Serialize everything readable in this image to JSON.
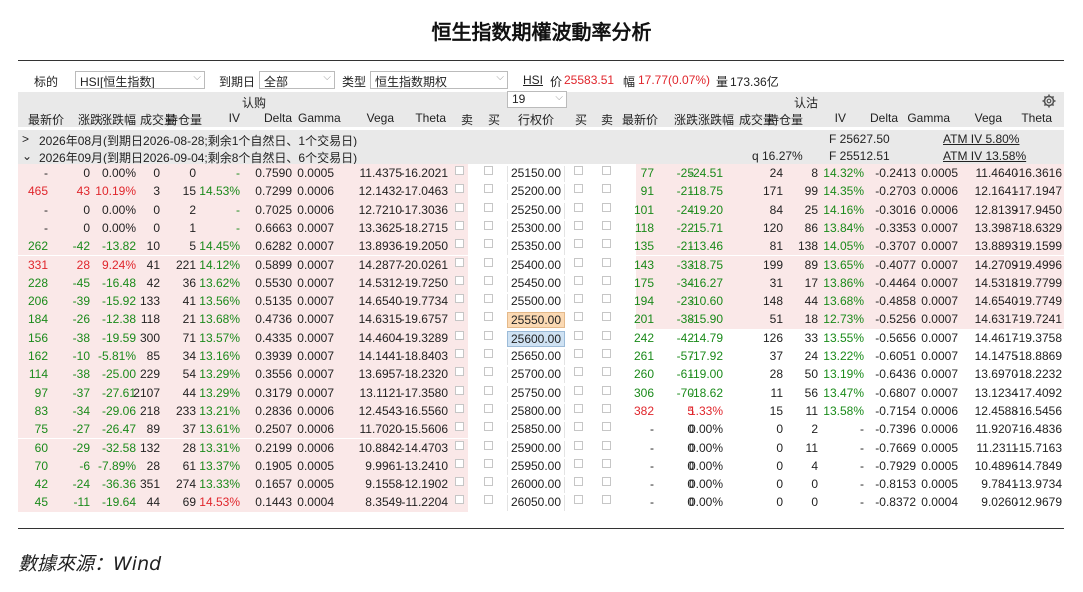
{
  "title": "恒生指数期權波動率分析",
  "source": "數據來源：Wind",
  "filter": {
    "underlying_label": "标的",
    "underlying_value": "HSI[恒生指数]",
    "expiry_label": "到期日",
    "expiry_value": "全部",
    "type_label": "类型",
    "type_value": "恒生指数期权",
    "hsi_link": "HSI",
    "price_label": "价",
    "price_value": "25583.51",
    "change_label": "幅",
    "change_value": "17.77(0.07%)",
    "volume_label": "量",
    "volume_value": "173.36亿"
  },
  "group_header": {
    "call_label": "认购",
    "strike_count": "19",
    "put_label": "认沽"
  },
  "columns": {
    "call": [
      "最新价",
      "涨跌",
      "涨跌幅",
      "成交量",
      "持仓量",
      "IV",
      "Delta",
      "Gamma",
      "Vega",
      "Theta",
      "卖",
      "买"
    ],
    "strike": "行权价",
    "put": [
      "买",
      "卖",
      "最新价",
      "涨跌",
      "涨跌幅",
      "成交量",
      "持仓量",
      "IV",
      "Delta",
      "Gamma",
      "Vega",
      "Theta"
    ]
  },
  "expiries": [
    {
      "label": "2026年08月(到期日2026-08-28;剩余1个自然日、1个交易日)",
      "q": "",
      "f": "F  25627.50",
      "atm": "ATM IV 5.80%"
    },
    {
      "label": "2026年09月(到期日2026-09-04;剩余8个自然日、6个交易日)",
      "q": "q  16.27%",
      "f": "F  25512.51",
      "atm": "ATM IV 13.58%"
    }
  ],
  "icons": {
    "settings": "gear-icon",
    "collapse": "chevron-icon",
    "dropdown": "chevron-down-icon",
    "checkbox": "checkbox-icon"
  },
  "colors": {
    "up": "#e0262c",
    "down": "#1a8a1a",
    "itm_background": "#fae8e8",
    "header_background": "#e9e9e9",
    "highlight_orange": "#fbd9b3",
    "highlight_blue": "#cfe2f3"
  },
  "rows": [
    {
      "c": [
        "-",
        "0",
        "0.00%",
        "0",
        "0",
        "-",
        "0.7590",
        "0.0005",
        "11.4375",
        "-16.2021"
      ],
      "k": "25150.00",
      "p": [
        "77",
        "-25",
        "-24.51",
        "24",
        "8",
        "14.32%",
        "-0.2413",
        "0.0005",
        "11.4640",
        "-16.3616"
      ]
    },
    {
      "c": [
        "465",
        "43",
        "10.19%",
        "3",
        "15",
        "14.53%",
        "0.7299",
        "0.0006",
        "12.1432",
        "-17.0463"
      ],
      "k": "25200.00",
      "p": [
        "91",
        "-21",
        "-18.75",
        "171",
        "99",
        "14.35%",
        "-0.2703",
        "0.0006",
        "12.1641",
        "-17.1947"
      ]
    },
    {
      "c": [
        "-",
        "0",
        "0.00%",
        "0",
        "2",
        "-",
        "0.7025",
        "0.0006",
        "12.7210",
        "-17.3036"
      ],
      "k": "25250.00",
      "p": [
        "101",
        "-24",
        "-19.20",
        "84",
        "25",
        "14.16%",
        "-0.3016",
        "0.0006",
        "12.8139",
        "-17.9450"
      ]
    },
    {
      "c": [
        "-",
        "0",
        "0.00%",
        "0",
        "1",
        "-",
        "0.6663",
        "0.0007",
        "13.3625",
        "-18.2715"
      ],
      "k": "25300.00",
      "p": [
        "118",
        "-22",
        "-15.71",
        "120",
        "86",
        "13.84%",
        "-0.3353",
        "0.0007",
        "13.3987",
        "-18.6329"
      ]
    },
    {
      "c": [
        "262",
        "-42",
        "-13.82",
        "10",
        "5",
        "14.45%",
        "0.6282",
        "0.0007",
        "13.8936",
        "-19.2050"
      ],
      "k": "25350.00",
      "p": [
        "135",
        "-21",
        "-13.46",
        "81",
        "138",
        "14.05%",
        "-0.3707",
        "0.0007",
        "13.8893",
        "-19.1599"
      ]
    },
    {
      "c": [
        "331",
        "28",
        "9.24%",
        "41",
        "221",
        "14.12%",
        "0.5899",
        "0.0007",
        "14.2877",
        "-20.0261"
      ],
      "k": "25400.00",
      "p": [
        "143",
        "-33",
        "-18.75",
        "199",
        "89",
        "13.65%",
        "-0.4077",
        "0.0007",
        "14.2709",
        "-19.4996"
      ]
    },
    {
      "c": [
        "228",
        "-45",
        "-16.48",
        "42",
        "36",
        "13.62%",
        "0.5530",
        "0.0007",
        "14.5312",
        "-19.7250"
      ],
      "k": "25450.00",
      "p": [
        "175",
        "-34",
        "-16.27",
        "31",
        "17",
        "13.86%",
        "-0.4464",
        "0.0007",
        "14.5318",
        "-19.7799"
      ]
    },
    {
      "c": [
        "206",
        "-39",
        "-15.92",
        "133",
        "41",
        "13.56%",
        "0.5135",
        "0.0007",
        "14.6540",
        "-19.7734"
      ],
      "k": "25500.00",
      "p": [
        "194",
        "-23",
        "-10.60",
        "148",
        "44",
        "13.68%",
        "-0.4858",
        "0.0007",
        "14.6540",
        "-19.7749"
      ]
    },
    {
      "c": [
        "184",
        "-26",
        "-12.38",
        "118",
        "21",
        "13.68%",
        "0.4736",
        "0.0007",
        "14.6315",
        "-19.6757"
      ],
      "k": "25550.00",
      "p": [
        "201",
        "-38",
        "-15.90",
        "51",
        "18",
        "12.73%",
        "-0.5256",
        "0.0007",
        "14.6317",
        "-19.7241"
      ]
    },
    {
      "c": [
        "156",
        "-38",
        "-19.59",
        "300",
        "71",
        "13.57%",
        "0.4335",
        "0.0007",
        "14.4604",
        "-19.3289"
      ],
      "k": "25600.00",
      "p": [
        "242",
        "-42",
        "-14.79",
        "126",
        "33",
        "13.55%",
        "-0.5656",
        "0.0007",
        "14.4617",
        "-19.3758"
      ]
    },
    {
      "c": [
        "162",
        "-10",
        "-5.81%",
        "85",
        "34",
        "13.16%",
        "0.3939",
        "0.0007",
        "14.1441",
        "-18.8403"
      ],
      "k": "25650.00",
      "p": [
        "261",
        "-57",
        "-17.92",
        "37",
        "24",
        "13.22%",
        "-0.6051",
        "0.0007",
        "14.1475",
        "-18.8869"
      ]
    },
    {
      "c": [
        "114",
        "-38",
        "-25.00",
        "229",
        "54",
        "13.29%",
        "0.3556",
        "0.0007",
        "13.6957",
        "-18.2320"
      ],
      "k": "25700.00",
      "p": [
        "260",
        "-61",
        "-19.00",
        "28",
        "50",
        "13.19%",
        "-0.6436",
        "0.0007",
        "13.6970",
        "-18.2232"
      ]
    },
    {
      "c": [
        "97",
        "-37",
        "-27.61",
        "2107",
        "44",
        "13.29%",
        "0.3179",
        "0.0007",
        "13.1121",
        "-17.3580"
      ],
      "k": "25750.00",
      "p": [
        "306",
        "-70",
        "-18.62",
        "11",
        "56",
        "13.47%",
        "-0.6807",
        "0.0007",
        "13.1234",
        "-17.4092"
      ]
    },
    {
      "c": [
        "83",
        "-34",
        "-29.06",
        "218",
        "233",
        "13.21%",
        "0.2836",
        "0.0006",
        "12.4543",
        "-16.5560"
      ],
      "k": "25800.00",
      "p": [
        "382",
        "5",
        "1.33%",
        "15",
        "11",
        "13.58%",
        "-0.7154",
        "0.0006",
        "12.4588",
        "-16.5456"
      ]
    },
    {
      "c": [
        "75",
        "-27",
        "-26.47",
        "89",
        "37",
        "13.61%",
        "0.2507",
        "0.0006",
        "11.7020",
        "-15.5606"
      ],
      "k": "25850.00",
      "p": [
        "-",
        "0",
        "0.00%",
        "0",
        "2",
        "-",
        "-0.7396",
        "0.0006",
        "11.9207",
        "-16.4836"
      ]
    },
    {
      "c": [
        "60",
        "-29",
        "-32.58",
        "132",
        "28",
        "13.31%",
        "0.2199",
        "0.0006",
        "10.8842",
        "-14.4703"
      ],
      "k": "25900.00",
      "p": [
        "-",
        "0",
        "0.00%",
        "0",
        "11",
        "-",
        "-0.7669",
        "0.0005",
        "11.2311",
        "-15.7163"
      ]
    },
    {
      "c": [
        "70",
        "-6",
        "-7.89%",
        "28",
        "61",
        "13.37%",
        "0.1905",
        "0.0005",
        "9.9961",
        "-13.2410"
      ],
      "k": "25950.00",
      "p": [
        "-",
        "0",
        "0.00%",
        "0",
        "4",
        "-",
        "-0.7929",
        "0.0005",
        "10.4896",
        "-14.7849"
      ]
    },
    {
      "c": [
        "42",
        "-24",
        "-36.36",
        "351",
        "274",
        "13.33%",
        "0.1657",
        "0.0005",
        "9.1558",
        "-12.1902"
      ],
      "k": "26000.00",
      "p": [
        "-",
        "0",
        "0.00%",
        "0",
        "0",
        "-",
        "-0.8153",
        "0.0005",
        "9.7841",
        "-13.9734"
      ]
    },
    {
      "c": [
        "45",
        "-11",
        "-19.64",
        "44",
        "69",
        "14.53%",
        "0.1443",
        "0.0004",
        "8.3549",
        "-11.2204"
      ],
      "k": "26050.00",
      "p": [
        "-",
        "0",
        "0.00%",
        "0",
        "0",
        "-",
        "-0.8372",
        "0.0004",
        "9.0260",
        "-12.9679"
      ]
    }
  ]
}
